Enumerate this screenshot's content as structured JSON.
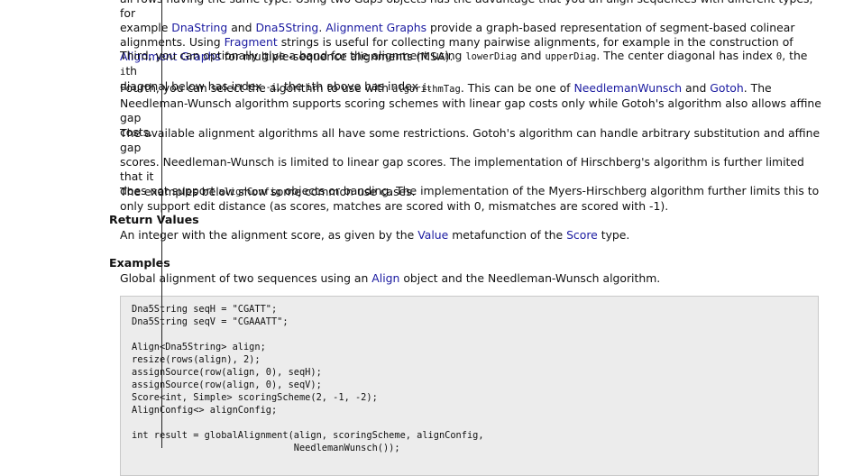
{
  "p_top": {
    "line1": "all rows having the same type. Using two Gaps objects has the advantage that you an align sequences with different types, for",
    "line2_a": "example ",
    "line2_link1": "DnaString",
    "line2_b": " and ",
    "line2_link2": "Dna5String",
    "line2_c": ". ",
    "line2_link3": "Alignment Graphs",
    "line2_d": " provide a graph-based representation of segment-based colinear",
    "line3_a": "alignments. Using ",
    "line3_link": "Fragment",
    "line3_b": " strings is useful for collecting many pairwise alignments, for example in the construction of",
    "line4_link": "Alignment Graphs",
    "line4_b": " for multiple-sequence alignments (MSA)."
  },
  "p_third": {
    "a": "Third, you can optionally give a band for the alignment using ",
    "code1": "lowerDiag",
    "b": " and ",
    "code2": "upperDiag",
    "c": ". The center diagonal has index ",
    "code3": "0",
    "d": ", the ",
    "code4": "i",
    "e": "th",
    "f": "diagonal below has index ",
    "code5": "-i",
    "g": ", the ",
    "code6": "i",
    "h": "th above has index ",
    "code7": "i",
    "i": "."
  },
  "p_fourth": {
    "a": "Fourth, you can select the algorithm to use with ",
    "code1": "algorithmTag",
    "b": ". This can be one of ",
    "link1": "NeedlemanWunsch",
    "c": " and ",
    "link2": "Gotoh",
    "d": ". The",
    "e": "Needleman-Wunsch algorithm supports scoring schemes with linear gap costs only while Gotoh's algorithm also allows affine gap",
    "f": "costs."
  },
  "p_avail": {
    "a": "The available alignment algorithms all have some restrictions. Gotoh's algorithm can handle arbitrary substitution and affine gap",
    "b": "scores. Needleman-Wunsch is limited to linear gap scores. The implementation of Hirschberg's algorithm is further limited that it",
    "c": "does not support ",
    "code1": "alignConfig",
    "d": " objects or banding. The implementation of the Myers-Hirschberg algorithm further limits this to",
    "e": "only support edit distance (as scores, matches are scored with 0, mismatches are scored with -1)."
  },
  "p_examples_intro": "The examples below show some common use cases.",
  "return_values": {
    "heading": "Return Values",
    "a": "An integer with the alignment score, as given by the ",
    "link1": "Value",
    "b": " metafunction of the ",
    "link2": "Score",
    "c": " type."
  },
  "examples": {
    "heading": "Examples",
    "a": "Global alignment of two sequences using an ",
    "link1": "Align",
    "b": " object and the Needleman-Wunsch algorithm."
  },
  "code_lines": [
    "Dna5String seqH = \"CGATT\";",
    "Dna5String seqV = \"CGAAATT\";",
    "",
    "Align<Dna5String> align;",
    "resize(rows(align), 2);",
    "assignSource(row(align, 0), seqH);",
    "assignSource(row(align, 0), seqV);",
    "Score<int, Simple> scoringScheme(2, -1, -2);",
    "AlignConfig<> alignConfig;",
    "",
    "int result = globalAlignment(align, scoringScheme, alignConfig,",
    "                             NeedlemanWunsch());"
  ]
}
